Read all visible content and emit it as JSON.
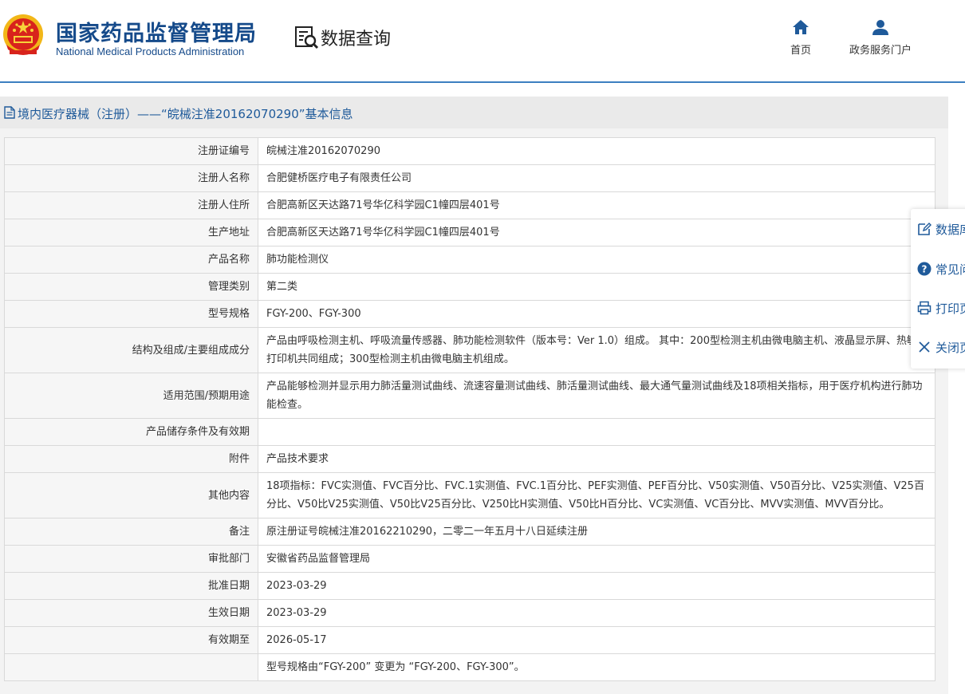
{
  "header": {
    "org_cn": "国家药品监督管理局",
    "org_en": "National Medical Products Administration",
    "query_label": "数据查询",
    "nav": [
      {
        "label": "首页",
        "icon": "home-icon"
      },
      {
        "label": "政务服务门户",
        "icon": "user-icon"
      }
    ]
  },
  "title": "境内医疗器械（注册）——“皖械注准20162070290”基本信息",
  "colors": {
    "brand": "#154a8a",
    "accent": "#1f5a9a",
    "rule": "#3c7fc1"
  },
  "rows": [
    {
      "label": "注册证编号",
      "value": "皖械注准20162070290"
    },
    {
      "label": "注册人名称",
      "value": "合肥健桥医疗电子有限责任公司"
    },
    {
      "label": "注册人住所",
      "value": "合肥高新区天达路71号华亿科学园C1幢四层401号"
    },
    {
      "label": "生产地址",
      "value": "合肥高新区天达路71号华亿科学园C1幢四层401号"
    },
    {
      "label": "产品名称",
      "value": "肺功能检测仪"
    },
    {
      "label": "管理类别",
      "value": "第二类"
    },
    {
      "label": "型号规格",
      "value": "FGY-200、FGY-300"
    },
    {
      "label": "结构及组成/主要组成成分",
      "value": "产品由呼吸检测主机、呼吸流量传感器、肺功能检测软件（版本号：Ver 1.0）组成。 其中：200型检测主机由微电脑主机、液晶显示屏、热敏打印机共同组成；300型检测主机由微电脑主机组成。"
    },
    {
      "label": "适用范围/预期用途",
      "value": "产品能够检测并显示用力肺活量测试曲线、流速容量测试曲线、肺活量测试曲线、最大通气量测试曲线及18项相关指标，用于医疗机构进行肺功能检查。"
    },
    {
      "label": "产品储存条件及有效期",
      "value": ""
    },
    {
      "label": "附件",
      "value": "产品技术要求"
    },
    {
      "label": "其他内容",
      "value": "18项指标：FVC实测值、FVC百分比、FVC.1实测值、FVC.1百分比、PEF实测值、PEF百分比、V50实测值、V50百分比、V25实测值、V25百分比、V50比V25实测值、V50比V25百分比、V250比H实测值、V50比H百分比、VC实测值、VC百分比、MVV实测值、MVV百分比。"
    },
    {
      "label": "备注",
      "value": "原注册证号皖械注准20162210290，二零二一年五月十八日延续注册"
    },
    {
      "label": "审批部门",
      "value": "安徽省药品监督管理局"
    },
    {
      "label": "批准日期",
      "value": "2023-03-29"
    },
    {
      "label": "生效日期",
      "value": "2023-03-29"
    },
    {
      "label": "有效期至",
      "value": "2026-05-17"
    },
    {
      "label": "",
      "value": "型号规格由“FGY-200” 变更为 “FGY-200、FGY-300”。"
    }
  ],
  "side_panel": [
    {
      "label": "数据库",
      "icon": "edit-icon"
    },
    {
      "label": "常见问题",
      "icon": "question-icon"
    },
    {
      "label": "打印页面",
      "icon": "print-icon"
    },
    {
      "label": "关闭页面",
      "icon": "close-icon"
    }
  ]
}
